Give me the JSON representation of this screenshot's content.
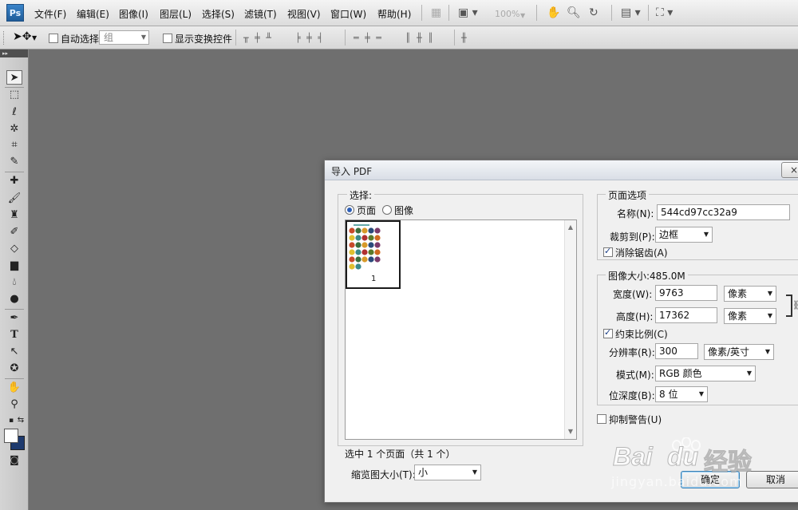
{
  "app": {
    "logo": "Ps",
    "menu": [
      "文件(F)",
      "编辑(E)",
      "图像(I)",
      "图层(L)",
      "选择(S)",
      "滤镜(T)",
      "视图(V)",
      "窗口(W)",
      "帮助(H)"
    ],
    "zoom": "100%"
  },
  "options_bar": {
    "auto_select_label": "自动选择:",
    "auto_select_value": "组",
    "auto_select_checked": false,
    "show_transform_label": "显示变换控件",
    "show_transform_checked": false
  },
  "tools": [
    "move",
    "marquee",
    "lasso",
    "magic-wand",
    "crop",
    "eyedropper",
    "healing",
    "brush",
    "clone-stamp",
    "history-brush",
    "eraser",
    "gradient",
    "blur",
    "dodge",
    "pen",
    "type",
    "path-select",
    "shape",
    "hand",
    "zoom"
  ],
  "colors": {
    "foreground": "#ffffff",
    "background": "#1e3a6e",
    "accent": "#3c7fb1"
  },
  "dialog": {
    "title": "导入 PDF",
    "close": "×",
    "select_group": {
      "legend": "选择:",
      "radio_page": "页面",
      "radio_image": "图像",
      "selected": "page",
      "thumbnail_page_number": "1",
      "status": "选中 1 个页面（共 1 个）",
      "thumb_size_label": "缩览图大小(T):",
      "thumb_size_value": "小"
    },
    "page_options": {
      "legend": "页面选项",
      "name_label": "名称(N):",
      "name_value": "544cd97cc32a9",
      "crop_label": "裁剪到(P):",
      "crop_value": "边框",
      "anti_alias_label": "消除锯齿(A)",
      "anti_alias_checked": true
    },
    "image_size": {
      "legend": "图像大小:485.0M",
      "width_label": "宽度(W):",
      "width_value": "9763",
      "width_unit": "像素",
      "height_label": "高度(H):",
      "height_value": "17362",
      "height_unit": "像素",
      "constrain_label": "约束比例(C)",
      "constrain_checked": true,
      "resolution_label": "分辨率(R):",
      "resolution_value": "300",
      "resolution_unit": "像素/英寸",
      "mode_label": "模式(M):",
      "mode_value": "RGB 颜色",
      "depth_label": "位深度(B):",
      "depth_value": "8 位"
    },
    "suppress_warnings_label": "抑制警告(U)",
    "suppress_warnings_checked": false,
    "ok": "确定",
    "cancel": "取消"
  },
  "watermark": {
    "brand": "Bai",
    "brand2": "du",
    "cn": "经验",
    "url": "jingyan.baidu.com"
  }
}
